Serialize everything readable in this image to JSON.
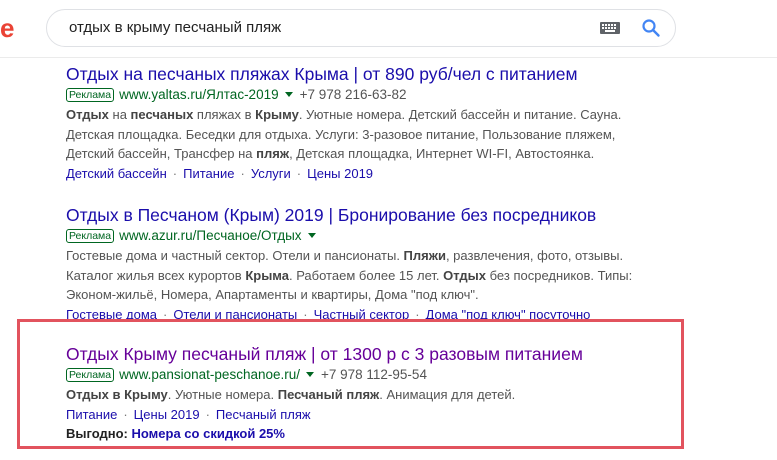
{
  "header": {
    "logo_text": "e",
    "search_value": "отдых в крыму песчаный пляж"
  },
  "results": [
    {
      "title": "Отдых на песчаных пляжах Крыма | от 890 руб/чел с питанием",
      "ad_badge": "Реклама",
      "display_url": "www.yaltas.ru/Ялтас-2019",
      "phone": "+7 978 216-63-82",
      "snippet": [
        [
          [
            "b",
            "Отдых"
          ],
          [
            "t",
            " на "
          ],
          [
            "b",
            "песчаных"
          ],
          [
            "t",
            " пляжах в "
          ],
          [
            "b",
            "Крыму"
          ],
          [
            "t",
            ". Уютные номера. Детский бассейн и питание. Сауна."
          ]
        ],
        [
          [
            "t",
            "Детская площадка. Беседки для отдыха. Услуги: 3-разовое питание, Пользование пляжем,"
          ]
        ],
        [
          [
            "t",
            "Детский бассейн, Трансфер на "
          ],
          [
            "b",
            "пляж"
          ],
          [
            "t",
            ", Детская площадка, Интернет WI-FI, Автостоянка."
          ]
        ]
      ],
      "sitelinks": [
        "Детский бассейн",
        "Питание",
        "Услуги",
        "Цены 2019"
      ]
    },
    {
      "title": "Отдых в Песчаном (Крым) 2019 | Бронирование без посредников",
      "ad_badge": "Реклама",
      "display_url": "www.azur.ru/Песчаное/Отдых",
      "snippet": [
        [
          [
            "t",
            "Гостевые дома и частный сектор. Отели и пансионаты. "
          ],
          [
            "b",
            "Пляжи"
          ],
          [
            "t",
            ", развлечения, фото, отзывы."
          ]
        ],
        [
          [
            "t",
            "Каталог жилья всех курортов "
          ],
          [
            "b",
            "Крыма"
          ],
          [
            "t",
            ". Работаем более 15 лет. "
          ],
          [
            "b",
            "Отдых"
          ],
          [
            "t",
            " без посредников. Типы:"
          ]
        ],
        [
          [
            "t",
            "Эконом-жильё, Номера, Апартаменты и квартиры, Дома \"под ключ\"."
          ]
        ]
      ],
      "sitelinks": [
        "Гостевые дома",
        "Отели и пансионаты",
        "Частный сектор",
        "Дома \"под ключ\" посуточно"
      ]
    },
    {
      "title": "Отдых Крыму песчаный пляж | от 1300 р с 3 разовым питанием",
      "ad_badge": "Реклама",
      "display_url": "www.pansionat-peschanoe.ru/",
      "phone": "+7 978 112-95-54",
      "snippet": [
        [
          [
            "b",
            "Отдых в Крыму"
          ],
          [
            "t",
            ". Уютные номера. "
          ],
          [
            "b",
            "Песчаный пляж"
          ],
          [
            "t",
            ". Анимация для детей."
          ]
        ]
      ],
      "sitelinks": [
        "Питание",
        "Цены 2019",
        "Песчаный пляж"
      ],
      "promo_label": "Выгодно:",
      "promo_link": "Номера со скидкой 25%"
    }
  ]
}
